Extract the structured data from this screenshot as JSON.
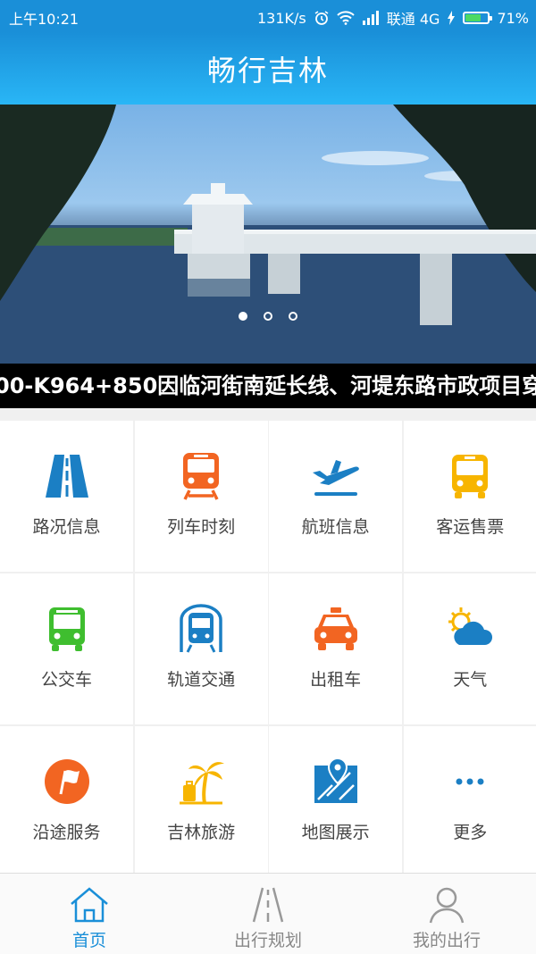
{
  "status_bar": {
    "time": "上午10:21",
    "net_speed": "131K/s",
    "carrier": "联通 4G",
    "battery": "71%",
    "battery_level": 0.71,
    "icons": [
      "alarm-icon",
      "wifi-icon",
      "signal-icon",
      "charging-icon",
      "battery-icon"
    ]
  },
  "header": {
    "title": "畅行吉林"
  },
  "banner": {
    "slide_count": 3,
    "active_index": 0
  },
  "ticker": {
    "text": "00-K964+850因临河街南延长线、河堤东路市政项目穿越"
  },
  "grid": {
    "items": [
      {
        "label": "路况信息",
        "icon": "road-icon",
        "color": "#1b7fc4"
      },
      {
        "label": "列车时刻",
        "icon": "train-icon",
        "color": "#f26522"
      },
      {
        "label": "航班信息",
        "icon": "airplane-icon",
        "color": "#1b7fc4"
      },
      {
        "label": "客运售票",
        "icon": "coach-bus-icon",
        "color": "#f7b500"
      },
      {
        "label": "公交车",
        "icon": "city-bus-icon",
        "color": "#3fbe2f"
      },
      {
        "label": "轨道交通",
        "icon": "subway-icon",
        "color": "#1b7fc4"
      },
      {
        "label": "出租车",
        "icon": "taxi-icon",
        "color": "#f26522"
      },
      {
        "label": "天气",
        "icon": "weather-icon",
        "color": "#1b7fc4"
      },
      {
        "label": "沿途服务",
        "icon": "flag-pin-icon",
        "color": "#f26522"
      },
      {
        "label": "吉林旅游",
        "icon": "palm-luggage-icon",
        "color": "#f7b500"
      },
      {
        "label": "地图展示",
        "icon": "map-pin-icon",
        "color": "#1b7fc4"
      },
      {
        "label": "更多",
        "icon": "more-dots-icon",
        "color": "#1b7fc4"
      }
    ]
  },
  "tabbar": {
    "tabs": [
      {
        "label": "首页",
        "icon": "home-icon",
        "active": true
      },
      {
        "label": "出行规划",
        "icon": "road-icon",
        "active": false
      },
      {
        "label": "我的出行",
        "icon": "user-icon",
        "active": false
      }
    ]
  },
  "colors": {
    "primary": "#1a8fd8",
    "orange": "#f26522",
    "yellow": "#f7b500",
    "green": "#3fbe2f"
  }
}
